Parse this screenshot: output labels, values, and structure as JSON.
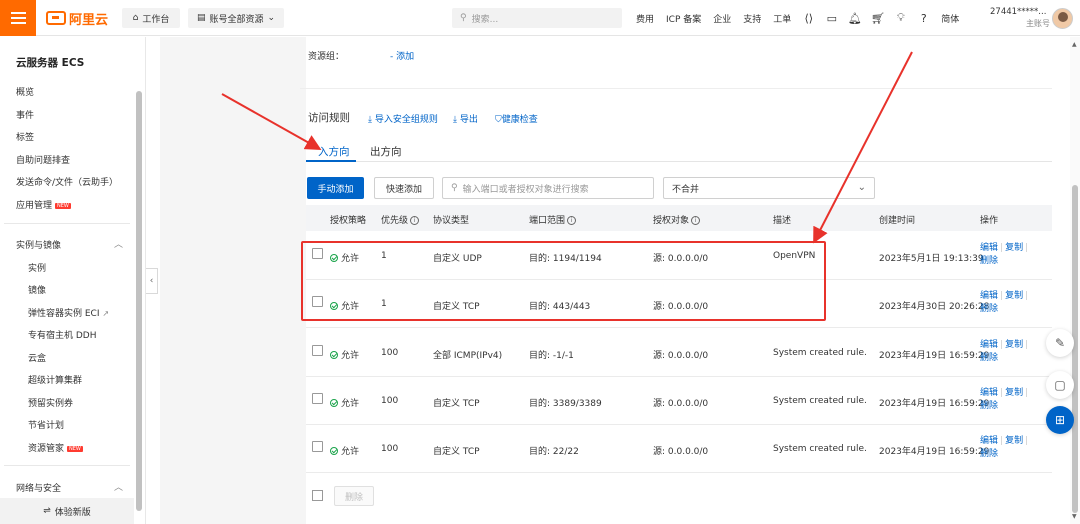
{
  "topbar": {
    "logo_text": "阿里云",
    "workspace_label": "工作台",
    "resource_label": "账号全部资源",
    "search_placeholder": "搜索...",
    "links": [
      "费用",
      "ICP 备案",
      "企业",
      "支持",
      "工单"
    ],
    "lang": "简体",
    "account_id": "27441*****...",
    "account_type": "主账号"
  },
  "sidebar": {
    "title": "云服务器 ECS",
    "items": [
      "概览",
      "事件",
      "标签",
      "自助问题排查",
      "发送命令/文件（云助手）",
      "应用管理"
    ],
    "app_mgmt_badge": "NEW",
    "section1": "实例与镜像",
    "section1_items": [
      "实例",
      "镜像",
      "弹性容器实例 ECI",
      "专有宿主机 DDH",
      "云盒",
      "超级计算集群",
      "预留实例券",
      "节省计划",
      "资源管家"
    ],
    "resource_badge": "NEW",
    "section2": "网络与安全",
    "bottom_label": "体验新版"
  },
  "main": {
    "resource_group_label": "资源组：",
    "resource_group_add": "- 添加",
    "access_rules_title": "访问规则",
    "import_label": "导入安全组规则",
    "export_label": "导出",
    "health_check_label": "健康检查",
    "tabs": [
      "入方向",
      "出方向"
    ],
    "btn_manual_add": "手动添加",
    "btn_quick_add": "快速添加",
    "filter_placeholder": "输入端口或者授权对象进行搜索",
    "merge_select": "不合并",
    "columns": [
      "授权策略",
      "优先级",
      "协议类型",
      "端口范围",
      "授权对象",
      "描述",
      "创建时间",
      "操作"
    ],
    "rows": [
      {
        "policy": "允许",
        "priority": "1",
        "protocol": "自定义 UDP",
        "port": "目的: 1194/1194",
        "source": "源: 0.0.0.0/0",
        "desc": "OpenVPN",
        "created": "2023年5月1日 19:13:39"
      },
      {
        "policy": "允许",
        "priority": "1",
        "protocol": "自定义 TCP",
        "port": "目的: 443/443",
        "source": "源: 0.0.0.0/0",
        "desc": "",
        "created": "2023年4月30日 20:26:28"
      },
      {
        "policy": "允许",
        "priority": "100",
        "protocol": "全部 ICMP(IPv4)",
        "port": "目的: -1/-1",
        "source": "源: 0.0.0.0/0",
        "desc": "System created rule.",
        "created": "2023年4月19日 16:59:29"
      },
      {
        "policy": "允许",
        "priority": "100",
        "protocol": "自定义 TCP",
        "port": "目的: 3389/3389",
        "source": "源: 0.0.0.0/0",
        "desc": "System created rule.",
        "created": "2023年4月19日 16:59:29"
      },
      {
        "policy": "允许",
        "priority": "100",
        "protocol": "自定义 TCP",
        "port": "目的: 22/22",
        "source": "源: 0.0.0.0/0",
        "desc": "System created rule.",
        "created": "2023年4月19日 16:59:29"
      }
    ],
    "op_edit": "编辑",
    "op_copy": "复制",
    "op_delete": "删除",
    "footer_delete": "删除"
  },
  "colors": {
    "brand": "#ff6a00",
    "primary": "#0064c8",
    "annotation_red": "#e8322b",
    "allow_green": "#1aa34a"
  }
}
